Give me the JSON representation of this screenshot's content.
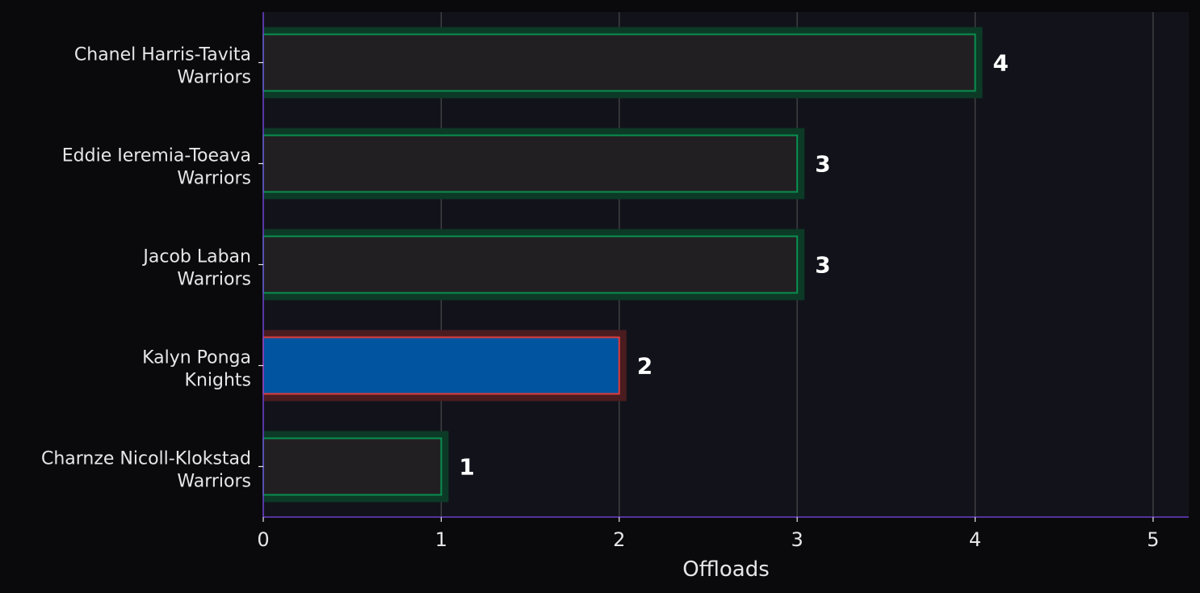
{
  "chart_data": {
    "type": "bar",
    "orientation": "horizontal",
    "xlabel": "Offloads",
    "ylabel": "",
    "title": "",
    "xlim": [
      0,
      5.2
    ],
    "xticks": [
      0,
      1,
      2,
      3,
      4,
      5
    ],
    "grid": "vertical",
    "categories": [
      {
        "name": "Chanel Harris-Tavita",
        "team": "Warriors"
      },
      {
        "name": "Eddie Ieremia-Toeava",
        "team": "Warriors"
      },
      {
        "name": "Jacob Laban",
        "team": "Warriors"
      },
      {
        "name": "Kalyn Ponga",
        "team": "Knights"
      },
      {
        "name": "Charnze Nicoll-Klokstad",
        "team": "Warriors"
      }
    ],
    "values": [
      4,
      3,
      3,
      2,
      1
    ],
    "highlight_index": 3,
    "colors": {
      "background": "#0a0a0d",
      "plot_background": "#12131a",
      "bar_fill": "#221f22",
      "bar_edge": "#0a8f4f",
      "bar_glow": "#0c3a27",
      "highlight_fill": "#0054a0",
      "highlight_edge": "#e03c3c",
      "highlight_glow": "#4a1c20",
      "axis": "#6a3fc8",
      "grid": "#454548",
      "text": "#e6e6e6",
      "value_text": "#ffffff"
    }
  }
}
